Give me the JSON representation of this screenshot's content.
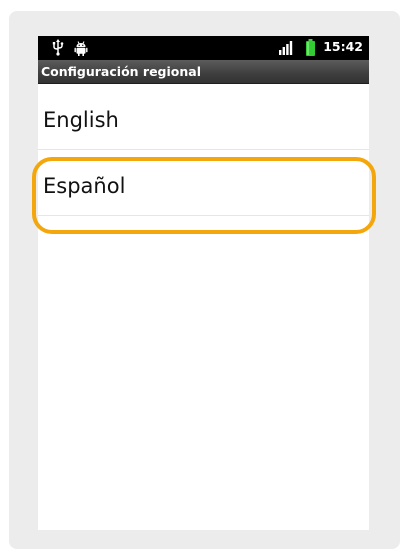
{
  "status_bar": {
    "time": "15:42",
    "icons": [
      "usb-icon",
      "android-debug-icon",
      "signal-icon",
      "battery-icon"
    ],
    "battery_color": "#33cc33"
  },
  "title_bar": {
    "title": "Configuración regional"
  },
  "language_list": {
    "items": [
      {
        "label": "English"
      },
      {
        "label": "Español"
      }
    ]
  },
  "annotation": {
    "highlight_color": "#f3a70d",
    "highlighted_item": "Español"
  }
}
